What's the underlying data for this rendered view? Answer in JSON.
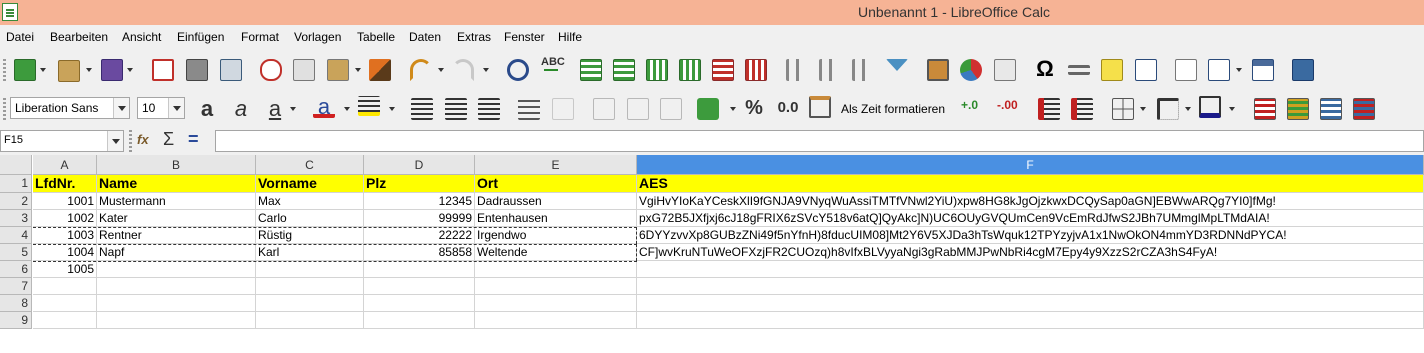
{
  "window": {
    "title": "Unbenannt 1 - LibreOffice Calc"
  },
  "menu": [
    "Datei",
    "Bearbeiten",
    "Ansicht",
    "Einfügen",
    "Format",
    "Vorlagen",
    "Tabelle",
    "Daten",
    "Extras",
    "Fenster",
    "Hilfe"
  ],
  "format_toolbar": {
    "font_name": "Liberation Sans",
    "font_size": "10",
    "time_format_label": "Als Zeit formatieren",
    "percent_label": "%",
    "decimal_label": "0.0",
    "omega_label": "Ω"
  },
  "formula_bar": {
    "name_box": "F15",
    "function_symbol": "fx",
    "sum_symbol": "Σ",
    "equals_symbol": "=",
    "content": ""
  },
  "sheet": {
    "columns": [
      "A",
      "B",
      "C",
      "D",
      "E",
      "F"
    ],
    "selected_column": "F",
    "rows": [
      "1",
      "2",
      "3",
      "4",
      "5",
      "6",
      "7",
      "8",
      "9"
    ],
    "header_row": [
      "LfdNr.",
      "Name",
      "Vorname",
      "Plz",
      "Ort",
      "AES"
    ],
    "data": [
      [
        "1001",
        "Mustermann",
        "Max",
        "12345",
        "Dadraussen",
        "VgiHvYIoKaYCeskXlI9fGNJA9VNyqWuAssiTMTfVNwl2YiU)xpw8HG8kJgOjzkwxDCQySap0aGN]EBWwARQg7YI0]fMg!"
      ],
      [
        "1002",
        "Kater",
        "Carlo",
        "99999",
        "Entenhausen",
        "pxG72B5JXfjxj6cJ18gFRIX6zSVcY518v6atQ]QyAkc]N)UC6OUyGVQUmCen9VcEmRdJfwS2JBh7UMmglMpLTMdAIA!"
      ],
      [
        "1003",
        "Rentner",
        "Rüstig",
        "22222",
        "Irgendwo",
        "6DYYzvvXp8GUBzZNi49f5nYfnH)8fducUIM08]Mt2Y6V5XJDa3hTsWquk12TPYzyjvA1x1NwOkON4mmYD3RDNNdPYCA!"
      ],
      [
        "1004",
        "Napf",
        "Karl",
        "85858",
        "Weltende",
        "CF]wvKruNTuWeOFXzjFR2CUOzq)h8vIfxBLVyyaNgi3gRabMMJPwNbRi4cgM7Epy4y9XzzS2rCZA3hS4FyA!"
      ],
      [
        "1005",
        "",
        "",
        "",
        "",
        ""
      ],
      [
        "",
        "",
        "",
        "",
        "",
        ""
      ],
      [
        "",
        "",
        "",
        "",
        "",
        ""
      ],
      [
        "",
        "",
        "",
        "",
        "",
        ""
      ]
    ]
  },
  "colors": {
    "titlebar": "#f6b395",
    "header_fill": "#ffff00",
    "selected_column": "#4a90e2"
  }
}
